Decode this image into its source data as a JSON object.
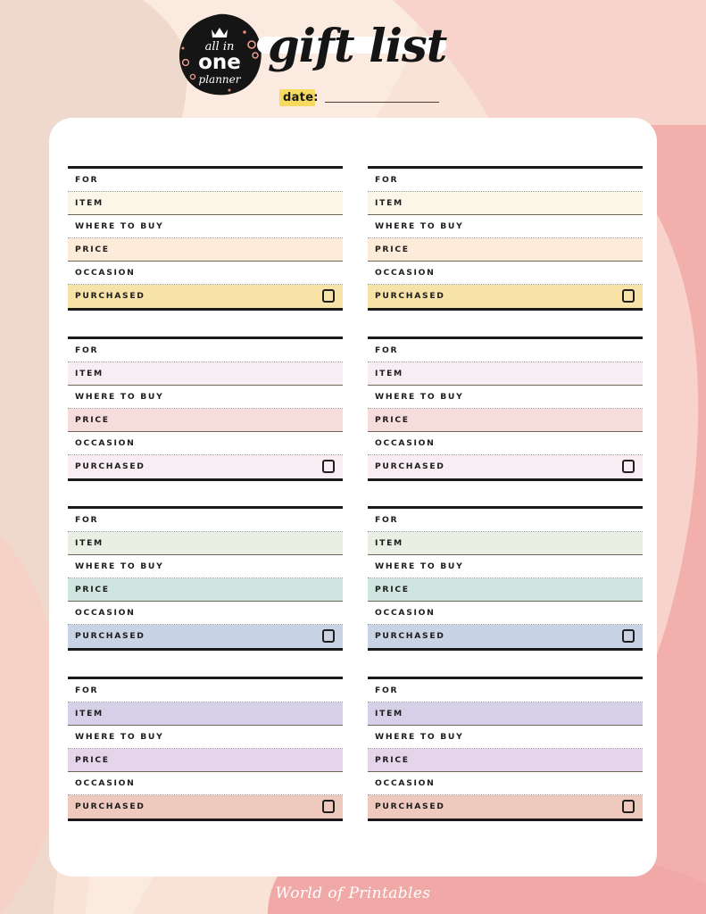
{
  "page": {
    "background_color": "#F7DDD2",
    "sheet_color": "#FFFFFF"
  },
  "header": {
    "logo": {
      "line1": "all in",
      "line2": "one",
      "line3": "planner",
      "icon": "crown-icon",
      "badge_color": "#151515"
    },
    "title": "gift list",
    "date_label": "date:",
    "date_highlight_color": "#F6D95F",
    "date_value": ""
  },
  "fields": {
    "for": "FOR",
    "item": "ITEM",
    "where_to_buy": "WHERE TO BUY",
    "price": "PRICE",
    "occasion": "OCCASION",
    "purchased": "PURCHASED"
  },
  "cards": [
    {
      "id": "card-1",
      "position": "row1-left",
      "item_color": "#FAF7E8",
      "price_color": "#FBEBD8",
      "purchased_color": "#F7E3A8",
      "for_value": "",
      "item_value": "",
      "where_value": "",
      "price_value": "",
      "occasion_value": "",
      "purchased_checked": false
    },
    {
      "id": "card-2",
      "position": "row1-right",
      "item_color": "#FAF7E8",
      "price_color": "#FBEBD8",
      "purchased_color": "#F7E3A8",
      "for_value": "",
      "item_value": "",
      "where_value": "",
      "price_value": "",
      "occasion_value": "",
      "purchased_checked": false
    },
    {
      "id": "card-3",
      "position": "row2-left",
      "item_color": "#F7EEF4",
      "price_color": "#F7DCDC",
      "purchased_color": "#F9EDF3",
      "for_value": "",
      "item_value": "",
      "where_value": "",
      "price_value": "",
      "occasion_value": "",
      "purchased_checked": false
    },
    {
      "id": "card-4",
      "position": "row2-right",
      "item_color": "#F7EEF4",
      "price_color": "#F7DCDC",
      "purchased_color": "#F9EDF3",
      "for_value": "",
      "item_value": "",
      "where_value": "",
      "price_value": "",
      "occasion_value": "",
      "purchased_checked": false
    },
    {
      "id": "card-5",
      "position": "row3-left",
      "item_color": "#E9F0E3",
      "price_color": "#CFE5E0",
      "purchased_color": "#C8D3E6",
      "for_value": "",
      "item_value": "",
      "where_value": "",
      "price_value": "",
      "occasion_value": "",
      "purchased_checked": false
    },
    {
      "id": "card-6",
      "position": "row3-right",
      "item_color": "#E9F0E3",
      "price_color": "#CFE5E0",
      "purchased_color": "#C8D3E6",
      "for_value": "",
      "item_value": "",
      "where_value": "",
      "price_value": "",
      "occasion_value": "",
      "purchased_checked": false
    },
    {
      "id": "card-7",
      "position": "row4-left",
      "item_color": "#D6CFE8",
      "price_color": "#E5D4EA",
      "purchased_color": "#EFC9BE",
      "for_value": "",
      "item_value": "",
      "where_value": "",
      "price_value": "",
      "occasion_value": "",
      "purchased_checked": false
    },
    {
      "id": "card-8",
      "position": "row4-right",
      "item_color": "#D6CFE8",
      "price_color": "#E5D4EA",
      "purchased_color": "#EFC9BE",
      "for_value": "",
      "item_value": "",
      "where_value": "",
      "price_value": "",
      "occasion_value": "",
      "purchased_checked": false
    }
  ],
  "footer": {
    "brand": "World of Printables",
    "heart": "♡"
  }
}
